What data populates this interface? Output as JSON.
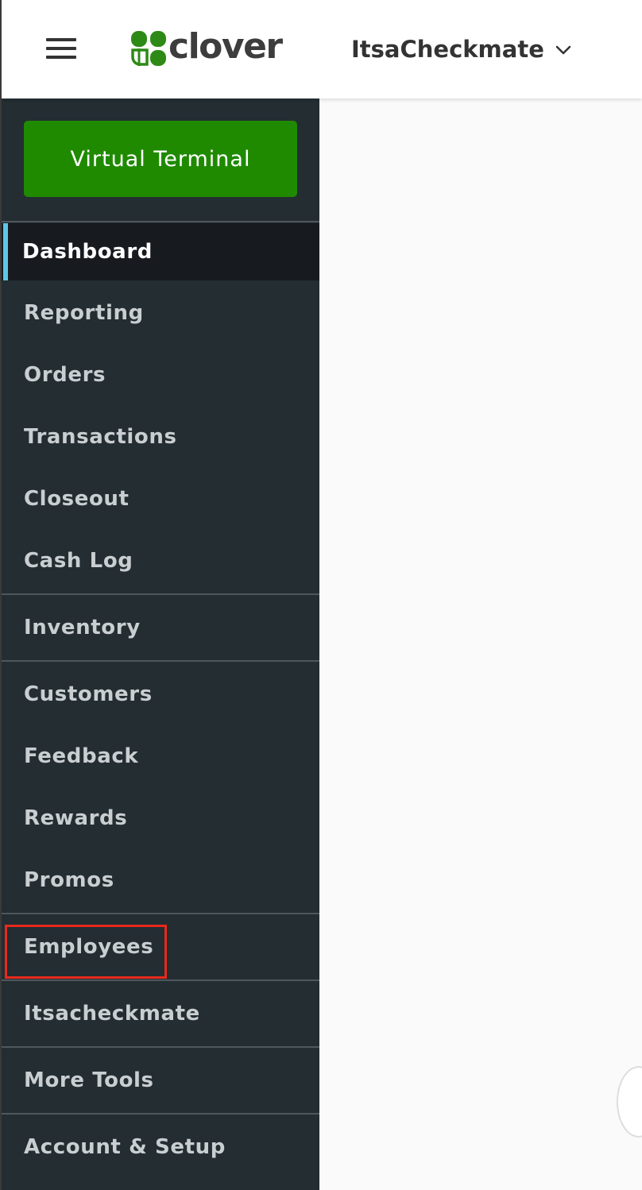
{
  "header": {
    "logo_text": "clover",
    "merchant_name": "ItsaCheckmate",
    "colors": {
      "brand_green": "#1f8a00",
      "logo_green": "#2d8a16"
    }
  },
  "sidebar": {
    "virtual_terminal_label": "Virtual Terminal",
    "items": [
      {
        "label": "Dashboard",
        "active": true
      },
      {
        "label": "Reporting"
      },
      {
        "label": "Orders"
      },
      {
        "label": "Transactions"
      },
      {
        "label": "Closeout"
      },
      {
        "label": "Cash Log"
      },
      {
        "label": "Inventory"
      },
      {
        "label": "Customers"
      },
      {
        "label": "Feedback"
      },
      {
        "label": "Rewards"
      },
      {
        "label": "Promos"
      },
      {
        "label": "Employees",
        "highlighted": true
      },
      {
        "label": "Itsacheckmate"
      },
      {
        "label": "More Tools"
      },
      {
        "label": "Account & Setup"
      }
    ],
    "colors": {
      "background": "#232d32",
      "active_indicator": "#5ec6e8",
      "highlight_border": "#e8291c"
    }
  },
  "icons": [
    "hamburger-menu-icon",
    "clover-leaf-icon",
    "chevron-down-icon"
  ]
}
